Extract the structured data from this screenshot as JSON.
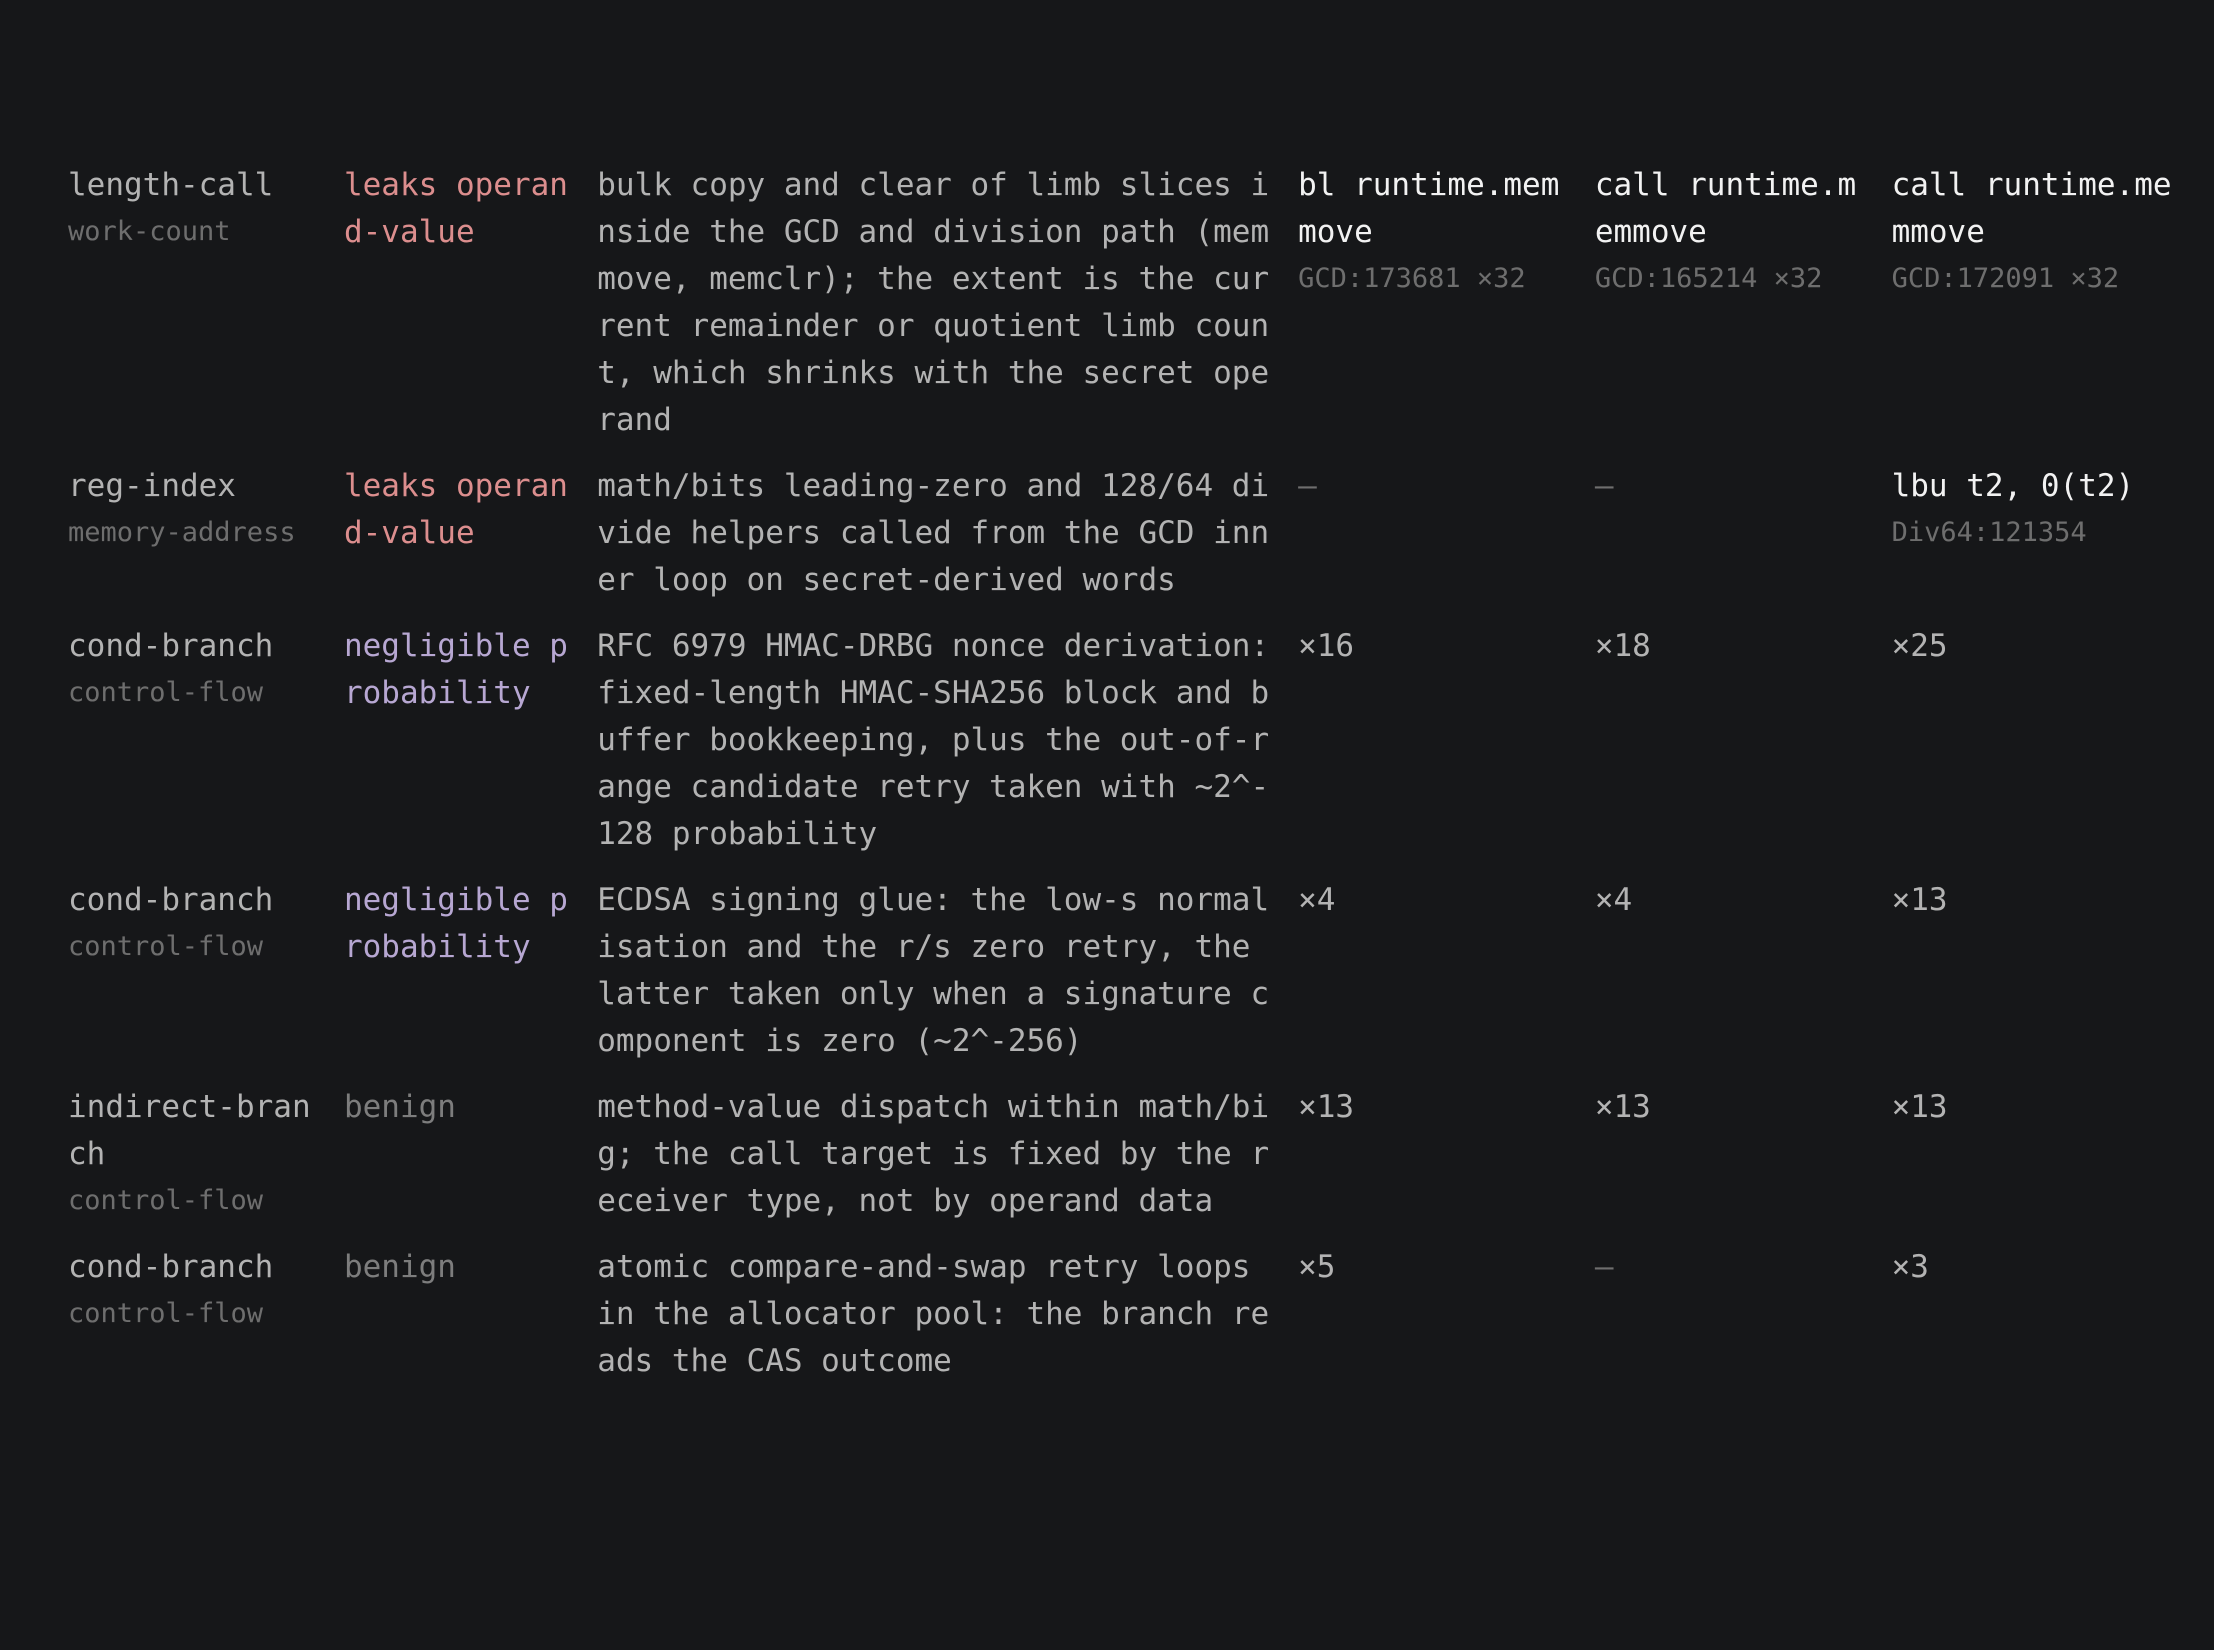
{
  "rows": [
    {
      "kind": "length-call",
      "category": "work-count",
      "verdict": "leaks operand-value",
      "description": "bulk copy and clear of limb slices inside the GCD and division path (memmove, memclr); the extent is the current remainder or quotient limb count, which shrinks with the secret operand",
      "arch1": {
        "instr": "bl runtime.memmove",
        "loc": "GCD:173681 ×32"
      },
      "arch2": {
        "instr": "call runtime.memmove",
        "loc": "GCD:165214 ×32"
      },
      "arch3": {
        "instr": "call runtime.memmove",
        "loc": "GCD:172091 ×32"
      }
    },
    {
      "kind": "reg-index",
      "category": "memory-address",
      "verdict": "leaks operand-value",
      "description": "math/bits leading-zero and 128/64 divide helpers called from the GCD inner loop on secret-derived words",
      "arch1": {
        "instr": "—"
      },
      "arch2": {
        "instr": "—"
      },
      "arch3": {
        "instr": "lbu t2, 0(t2)",
        "loc": "Div64:121354"
      }
    },
    {
      "kind": "cond-branch",
      "category": "control-flow",
      "verdict": "negligible probability",
      "description": "RFC 6979 HMAC-DRBG nonce derivation: fixed-length HMAC-SHA256 block and buffer bookkeeping, plus the out-of-range candidate retry taken with ~2^-128 probability",
      "arch1": {
        "instr": "×16"
      },
      "arch2": {
        "instr": "×18"
      },
      "arch3": {
        "instr": "×25"
      }
    },
    {
      "kind": "cond-branch",
      "category": "control-flow",
      "verdict": "negligible probability",
      "description": "ECDSA signing glue: the low-s normalisation and the r/s zero retry, the latter taken only when a signature component is zero (~2^-256)",
      "arch1": {
        "instr": "×4"
      },
      "arch2": {
        "instr": "×4"
      },
      "arch3": {
        "instr": "×13"
      }
    },
    {
      "kind": "indirect-branch",
      "category": "control-flow",
      "verdict": "benign",
      "description": "method-value dispatch within math/big; the call target is fixed by the receiver type, not by operand data",
      "arch1": {
        "instr": "×13"
      },
      "arch2": {
        "instr": "×13"
      },
      "arch3": {
        "instr": "×13"
      }
    },
    {
      "kind": "cond-branch",
      "category": "control-flow",
      "verdict": "benign",
      "description": "atomic compare-and-swap retry loops in the allocator pool: the branch reads the CAS outcome",
      "arch1": {
        "instr": "×5"
      },
      "arch2": {
        "instr": "—"
      },
      "arch3": {
        "instr": "×3"
      }
    }
  ]
}
